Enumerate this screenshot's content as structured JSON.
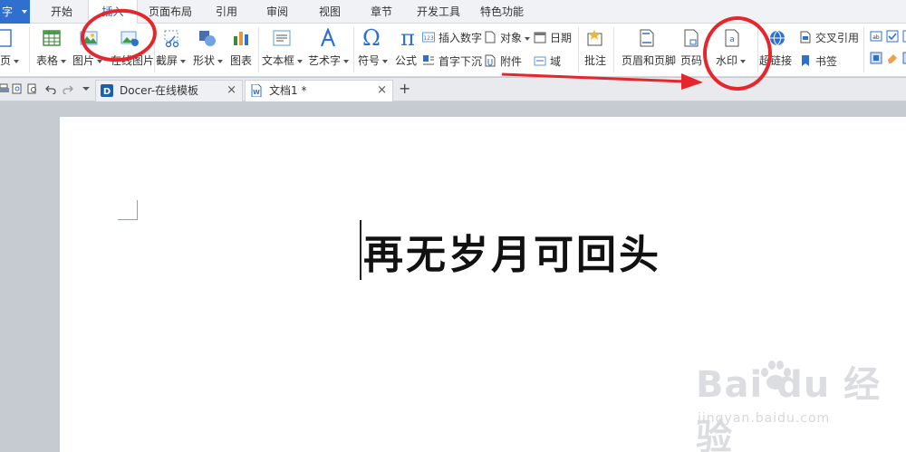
{
  "app": {
    "button_label": "字"
  },
  "menu": {
    "tabs": [
      {
        "label": "开始"
      },
      {
        "label": "插入"
      },
      {
        "label": "页面布局"
      },
      {
        "label": "引用"
      },
      {
        "label": "审阅"
      },
      {
        "label": "视图"
      },
      {
        "label": "章节"
      },
      {
        "label": "开发工具"
      },
      {
        "label": "特色功能"
      }
    ],
    "active_tab": "插入"
  },
  "ribbon": {
    "page_label": "页",
    "table_label": "表格",
    "picture_label": "图片",
    "online_picture_label": "在线图片",
    "screenshot_label": "截屏",
    "shape_label": "形状",
    "chart_label": "图表",
    "textbox_label": "文本框",
    "wordart_label": "艺术字",
    "symbol_label": "符号",
    "formula_label": "公式",
    "insert_number_label": "插入数字",
    "dropcap_label": "首字下沉",
    "object_label": "对象",
    "attachment_label": "附件",
    "date_label": "日期",
    "field_label": "域",
    "comment_label": "批注",
    "header_footer_label": "页眉和页脚",
    "page_number_label": "页码",
    "watermark_label": "水印",
    "hyperlink_label": "超链接",
    "cross_ref_label": "交叉引用",
    "bookmark_label": "书签"
  },
  "tabs": [
    {
      "label": "Docer-在线模板",
      "close": "×"
    },
    {
      "label": "文档1 *",
      "close": "×"
    }
  ],
  "new_tab": "+",
  "document": {
    "text": "再无岁月可回头"
  },
  "watermark": {
    "logo": "Bai  du 经验",
    "url": "jingyan.baidu.com"
  },
  "colors": {
    "accent": "#2f6fcf",
    "annotation": "#e5272d"
  }
}
